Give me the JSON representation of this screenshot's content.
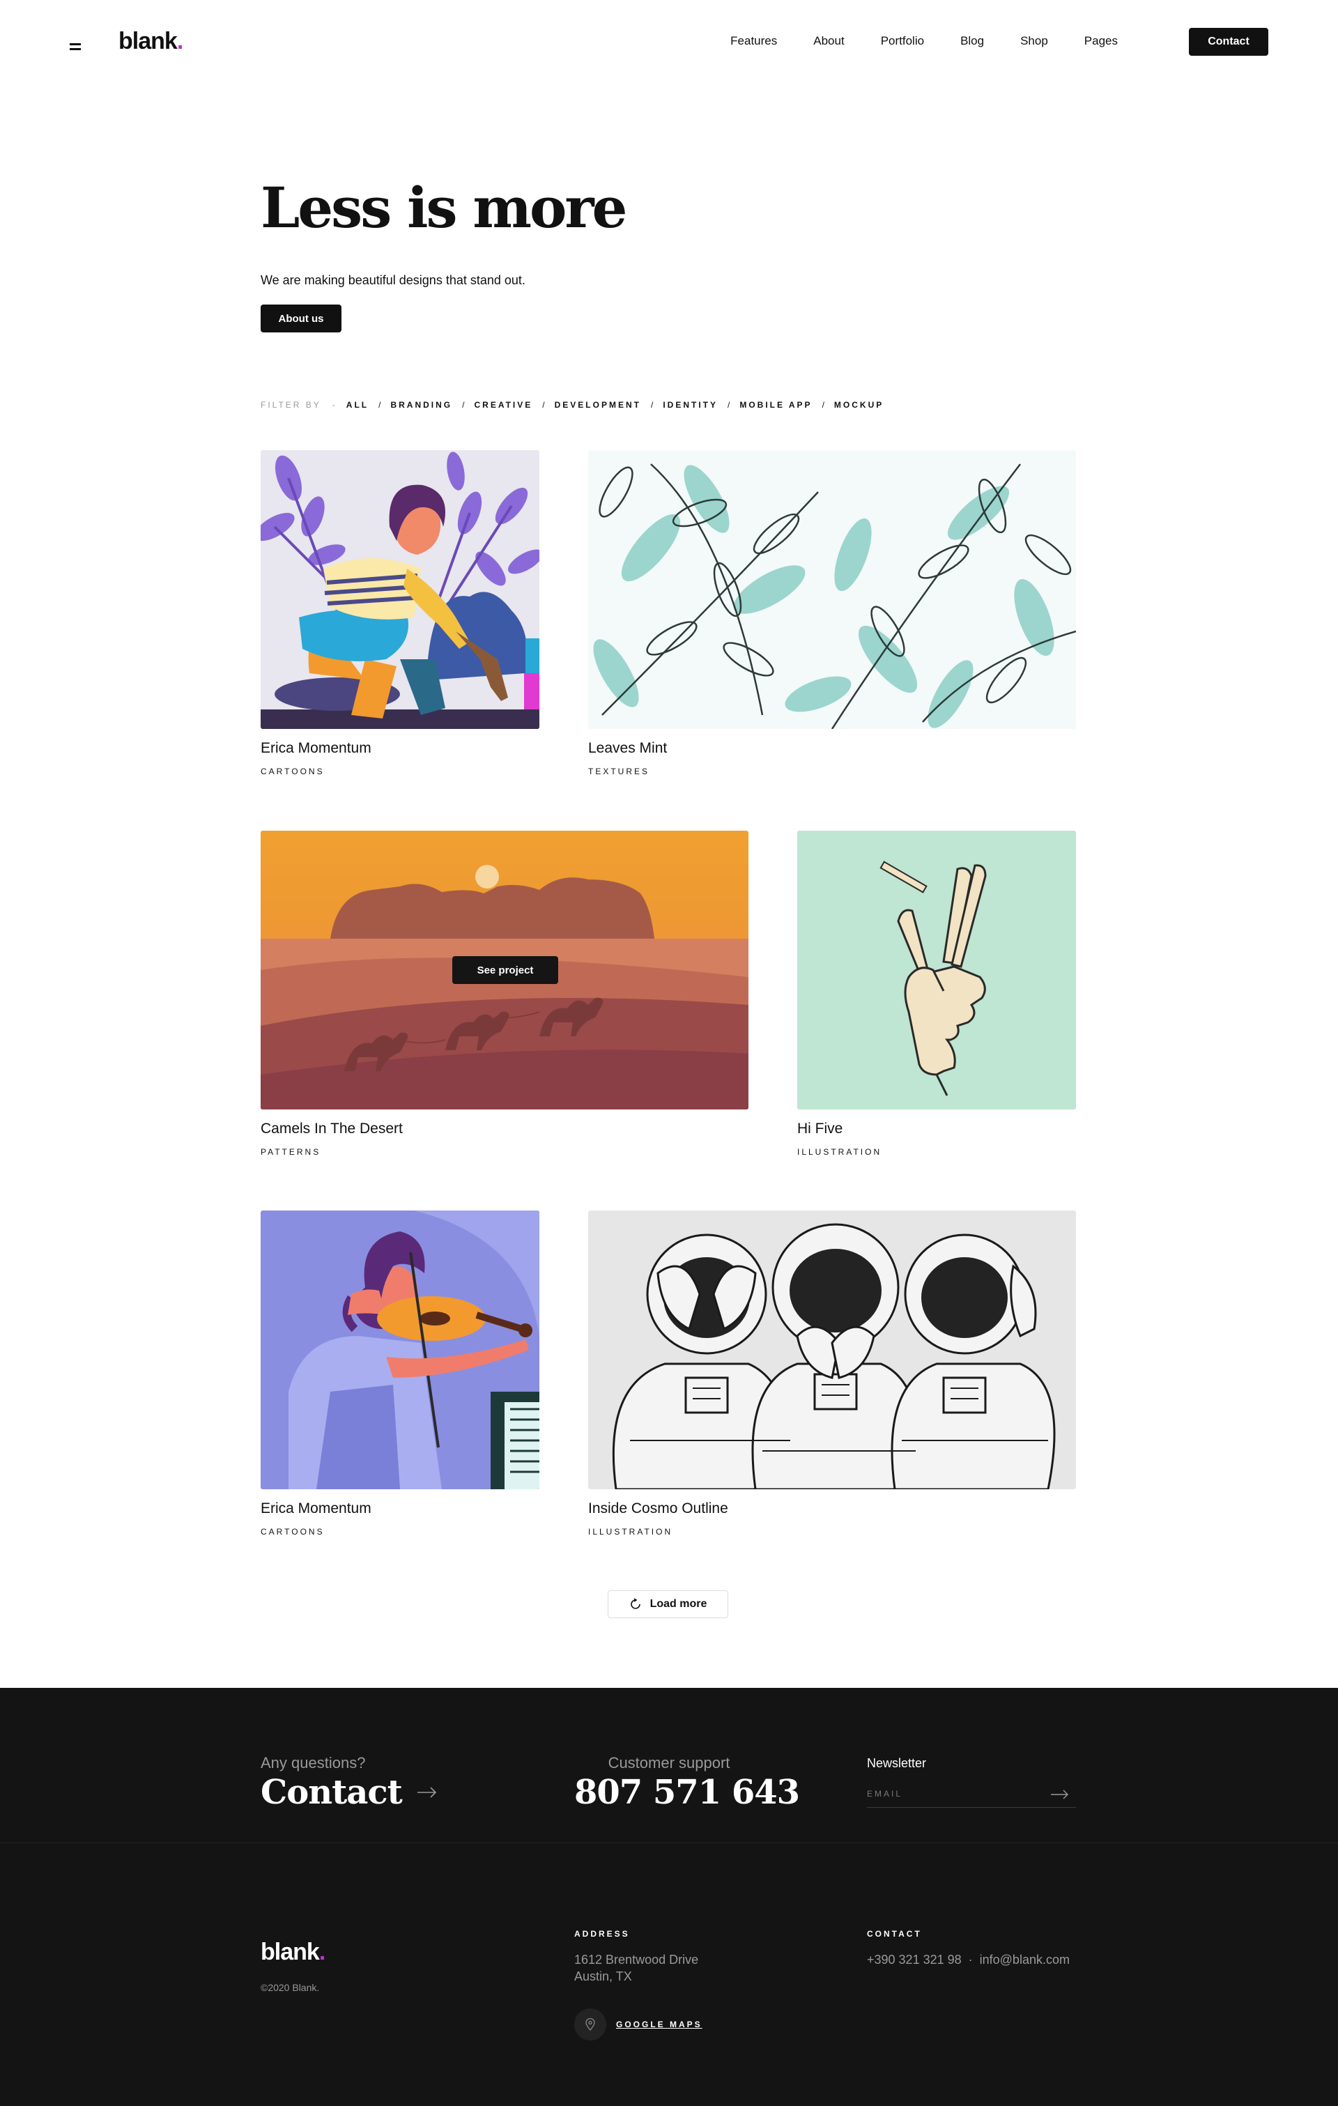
{
  "header": {
    "logo": "blank",
    "logo_dot": ".",
    "nav": [
      "Features",
      "About",
      "Portfolio",
      "Blog",
      "Shop",
      "Pages"
    ],
    "contact_label": "Contact"
  },
  "hero": {
    "title": "Less is more",
    "subtitle": "We are making beautiful designs that stand out.",
    "button": "About us"
  },
  "filter": {
    "label": "FILTER BY",
    "dash": "-",
    "items": [
      "ALL",
      "BRANDING",
      "CREATIVE",
      "DEVELOPMENT",
      "IDENTITY",
      "MOBILE APP",
      "MOCKUP"
    ],
    "separator": "/"
  },
  "portfolio": [
    {
      "title": "Erica Momentum",
      "category": "CARTOONS"
    },
    {
      "title": "Leaves Mint",
      "category": "TEXTURES"
    },
    {
      "title": "Camels In The Desert",
      "category": "PATTERNS",
      "hover_button": "See project"
    },
    {
      "title": "Hi Five",
      "category": "ILLUSTRATION"
    },
    {
      "title": "Erica Momentum",
      "category": "CARTOONS"
    },
    {
      "title": "Inside Cosmo Outline",
      "category": "ILLUSTRATION"
    }
  ],
  "load_more": "Load more",
  "footer": {
    "questions": "Any questions?",
    "contact_big": "Contact",
    "support_label": "Customer support",
    "phone": "807 571 643",
    "newsletter_title": "Newsletter",
    "email_placeholder": "EMAIL",
    "logo": "blank",
    "logo_dot": ".",
    "copyright": "©2020 Blank.",
    "address_label": "ADDRESS",
    "address_line1": "1612  Brentwood Drive",
    "address_line2": "Austin, TX",
    "maps_label": "GOOGLE MAPS",
    "contact_label": "CONTACT",
    "phone_small": "+390 321 321 98",
    "contact_sep": "·",
    "email": "info@blank.com"
  },
  "colors": {
    "accent": "#c02fd6",
    "dark": "#141414",
    "text": "#111111"
  }
}
